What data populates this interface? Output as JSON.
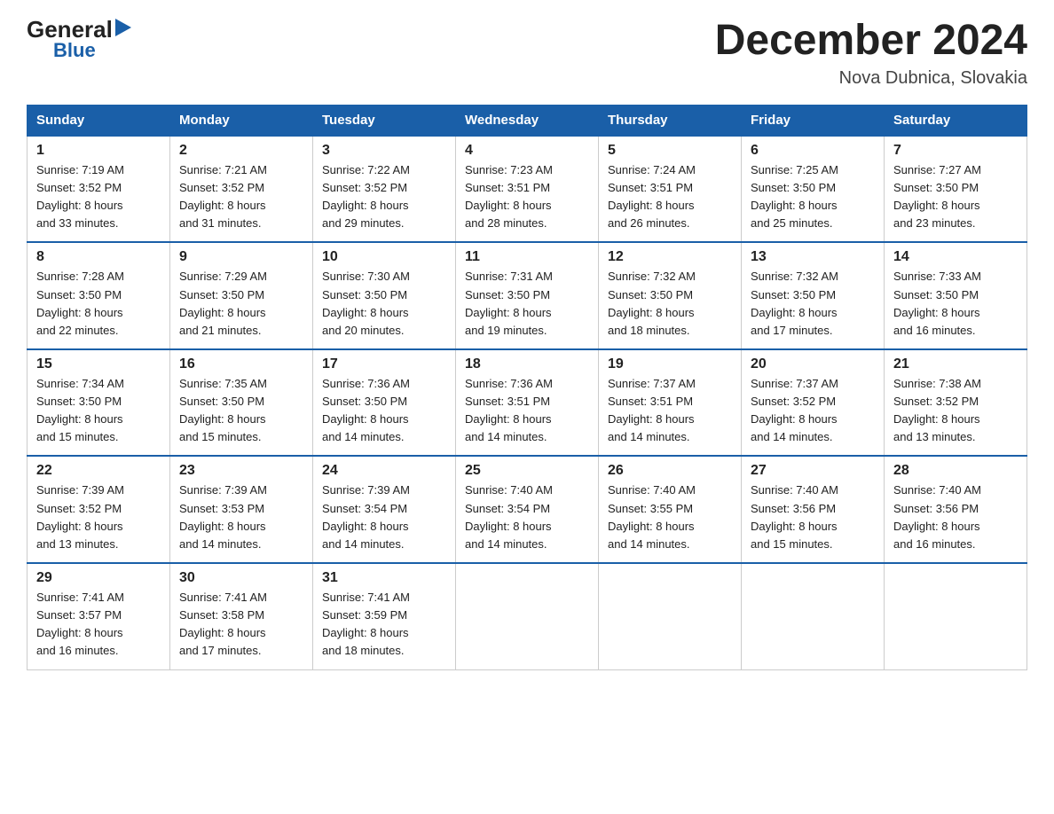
{
  "header": {
    "logo_general": "General",
    "logo_triangle": "▶",
    "logo_blue": "Blue",
    "month_title": "December 2024",
    "subtitle": "Nova Dubnica, Slovakia"
  },
  "days_of_week": [
    "Sunday",
    "Monday",
    "Tuesday",
    "Wednesday",
    "Thursday",
    "Friday",
    "Saturday"
  ],
  "weeks": [
    [
      {
        "day": "1",
        "sunrise": "7:19 AM",
        "sunset": "3:52 PM",
        "daylight": "8 hours and 33 minutes."
      },
      {
        "day": "2",
        "sunrise": "7:21 AM",
        "sunset": "3:52 PM",
        "daylight": "8 hours and 31 minutes."
      },
      {
        "day": "3",
        "sunrise": "7:22 AM",
        "sunset": "3:52 PM",
        "daylight": "8 hours and 29 minutes."
      },
      {
        "day": "4",
        "sunrise": "7:23 AM",
        "sunset": "3:51 PM",
        "daylight": "8 hours and 28 minutes."
      },
      {
        "day": "5",
        "sunrise": "7:24 AM",
        "sunset": "3:51 PM",
        "daylight": "8 hours and 26 minutes."
      },
      {
        "day": "6",
        "sunrise": "7:25 AM",
        "sunset": "3:50 PM",
        "daylight": "8 hours and 25 minutes."
      },
      {
        "day": "7",
        "sunrise": "7:27 AM",
        "sunset": "3:50 PM",
        "daylight": "8 hours and 23 minutes."
      }
    ],
    [
      {
        "day": "8",
        "sunrise": "7:28 AM",
        "sunset": "3:50 PM",
        "daylight": "8 hours and 22 minutes."
      },
      {
        "day": "9",
        "sunrise": "7:29 AM",
        "sunset": "3:50 PM",
        "daylight": "8 hours and 21 minutes."
      },
      {
        "day": "10",
        "sunrise": "7:30 AM",
        "sunset": "3:50 PM",
        "daylight": "8 hours and 20 minutes."
      },
      {
        "day": "11",
        "sunrise": "7:31 AM",
        "sunset": "3:50 PM",
        "daylight": "8 hours and 19 minutes."
      },
      {
        "day": "12",
        "sunrise": "7:32 AM",
        "sunset": "3:50 PM",
        "daylight": "8 hours and 18 minutes."
      },
      {
        "day": "13",
        "sunrise": "7:32 AM",
        "sunset": "3:50 PM",
        "daylight": "8 hours and 17 minutes."
      },
      {
        "day": "14",
        "sunrise": "7:33 AM",
        "sunset": "3:50 PM",
        "daylight": "8 hours and 16 minutes."
      }
    ],
    [
      {
        "day": "15",
        "sunrise": "7:34 AM",
        "sunset": "3:50 PM",
        "daylight": "8 hours and 15 minutes."
      },
      {
        "day": "16",
        "sunrise": "7:35 AM",
        "sunset": "3:50 PM",
        "daylight": "8 hours and 15 minutes."
      },
      {
        "day": "17",
        "sunrise": "7:36 AM",
        "sunset": "3:50 PM",
        "daylight": "8 hours and 14 minutes."
      },
      {
        "day": "18",
        "sunrise": "7:36 AM",
        "sunset": "3:51 PM",
        "daylight": "8 hours and 14 minutes."
      },
      {
        "day": "19",
        "sunrise": "7:37 AM",
        "sunset": "3:51 PM",
        "daylight": "8 hours and 14 minutes."
      },
      {
        "day": "20",
        "sunrise": "7:37 AM",
        "sunset": "3:52 PM",
        "daylight": "8 hours and 14 minutes."
      },
      {
        "day": "21",
        "sunrise": "7:38 AM",
        "sunset": "3:52 PM",
        "daylight": "8 hours and 13 minutes."
      }
    ],
    [
      {
        "day": "22",
        "sunrise": "7:39 AM",
        "sunset": "3:52 PM",
        "daylight": "8 hours and 13 minutes."
      },
      {
        "day": "23",
        "sunrise": "7:39 AM",
        "sunset": "3:53 PM",
        "daylight": "8 hours and 14 minutes."
      },
      {
        "day": "24",
        "sunrise": "7:39 AM",
        "sunset": "3:54 PM",
        "daylight": "8 hours and 14 minutes."
      },
      {
        "day": "25",
        "sunrise": "7:40 AM",
        "sunset": "3:54 PM",
        "daylight": "8 hours and 14 minutes."
      },
      {
        "day": "26",
        "sunrise": "7:40 AM",
        "sunset": "3:55 PM",
        "daylight": "8 hours and 14 minutes."
      },
      {
        "day": "27",
        "sunrise": "7:40 AM",
        "sunset": "3:56 PM",
        "daylight": "8 hours and 15 minutes."
      },
      {
        "day": "28",
        "sunrise": "7:40 AM",
        "sunset": "3:56 PM",
        "daylight": "8 hours and 16 minutes."
      }
    ],
    [
      {
        "day": "29",
        "sunrise": "7:41 AM",
        "sunset": "3:57 PM",
        "daylight": "8 hours and 16 minutes."
      },
      {
        "day": "30",
        "sunrise": "7:41 AM",
        "sunset": "3:58 PM",
        "daylight": "8 hours and 17 minutes."
      },
      {
        "day": "31",
        "sunrise": "7:41 AM",
        "sunset": "3:59 PM",
        "daylight": "8 hours and 18 minutes."
      },
      null,
      null,
      null,
      null
    ]
  ],
  "labels": {
    "sunrise": "Sunrise:",
    "sunset": "Sunset:",
    "daylight": "Daylight:"
  }
}
